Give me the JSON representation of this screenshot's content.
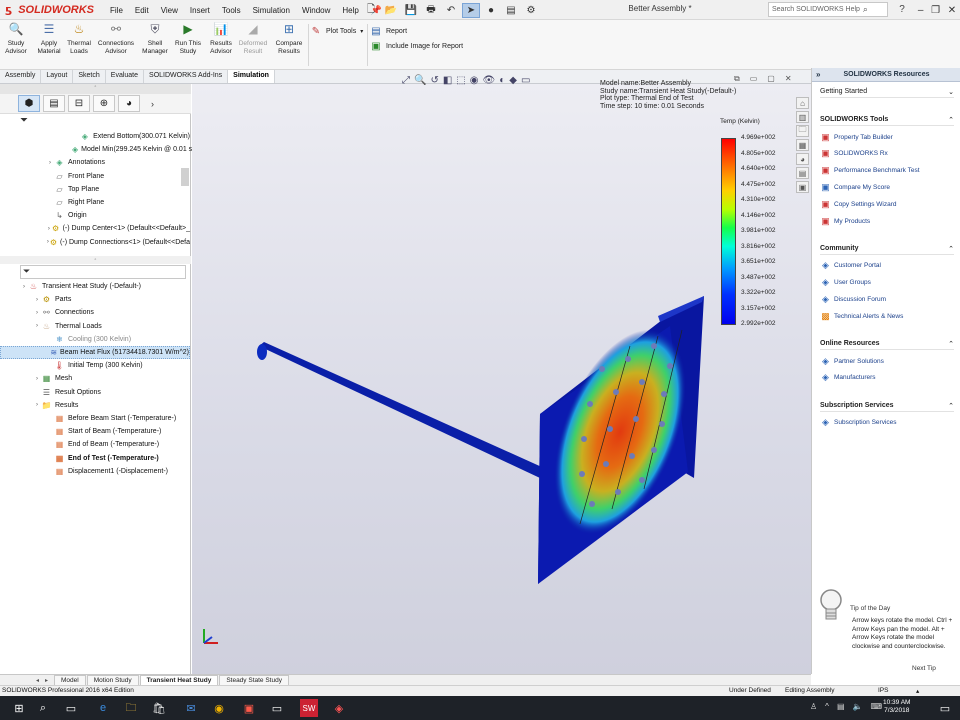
{
  "titlebar": {
    "logo": "SOLIDWORKS",
    "menu": [
      "File",
      "Edit",
      "View",
      "Insert",
      "Tools",
      "Simulation",
      "Window",
      "Help"
    ],
    "document_title": "Better Assembly *",
    "search_placeholder": "Search SOLIDWORKS Help"
  },
  "ribbon": {
    "buttons": [
      {
        "label": "Study Advisor",
        "icon": "study-advisor-icon"
      },
      {
        "label": "Apply Material",
        "icon": "apply-material-icon"
      },
      {
        "label": "Thermal Loads",
        "icon": "thermal-loads-icon"
      },
      {
        "label": "Connections Advisor",
        "icon": "connections-icon"
      },
      {
        "label": "Shell Manager",
        "icon": "shell-manager-icon"
      },
      {
        "label": "Run This Study",
        "icon": "run-study-icon"
      },
      {
        "label": "Results Advisor",
        "icon": "results-advisor-icon"
      },
      {
        "label": "Deformed Result",
        "icon": "deformed-result-icon",
        "disabled": true
      },
      {
        "label": "Compare Results",
        "icon": "compare-results-icon"
      }
    ],
    "plot_tools": "Plot Tools",
    "report": "Report",
    "include_image": "Include Image for Report"
  },
  "command_tabs": [
    "Assembly",
    "Layout",
    "Sketch",
    "Evaluate",
    "SOLIDWORKS Add-Ins",
    "Simulation"
  ],
  "active_command_tab": "Simulation",
  "tree_top": [
    {
      "label": "Extend Bottom(300.071 Kelvin)",
      "indent": 4,
      "icon": "annotation"
    },
    {
      "label": "Model Min(299.245 Kelvin @ 0.01 sec)",
      "indent": 4,
      "icon": "annotation"
    },
    {
      "label": "Annotations",
      "indent": 2,
      "icon": "annotation",
      "expand": true
    },
    {
      "label": "Front Plane",
      "indent": 2,
      "icon": "plane"
    },
    {
      "label": "Top Plane",
      "indent": 2,
      "icon": "plane"
    },
    {
      "label": "Right Plane",
      "indent": 2,
      "icon": "plane"
    },
    {
      "label": "Origin",
      "indent": 2,
      "icon": "origin"
    },
    {
      "label": "(-) Dump Center<1> (Default<<Default>_",
      "indent": 2,
      "icon": "part",
      "expand": true
    },
    {
      "label": "(-) Dump Connections<1> (Default<<Defa",
      "indent": 2,
      "icon": "part",
      "expand": true
    }
  ],
  "tree_study": [
    {
      "label": "Transient Heat Study (-Default-)",
      "indent": 0,
      "icon": "study",
      "expand": true
    },
    {
      "label": "Parts",
      "indent": 1,
      "icon": "parts",
      "expand": true
    },
    {
      "label": "Connections",
      "indent": 1,
      "icon": "connections",
      "expand": true
    },
    {
      "label": "Thermal Loads",
      "indent": 1,
      "icon": "thermal",
      "expand": true
    },
    {
      "label": "Cooling (300 Kelvin)",
      "indent": 2,
      "icon": "cooling",
      "gray": true
    },
    {
      "label": "Beam Heat Flux (51734418.7301 W/m^2)",
      "indent": 2,
      "icon": "flux",
      "selected": true
    },
    {
      "label": "Initial Temp (300 Kelvin)",
      "indent": 2,
      "icon": "temp"
    },
    {
      "label": "Mesh",
      "indent": 1,
      "icon": "mesh",
      "expand": true
    },
    {
      "label": "Result Options",
      "indent": 1,
      "icon": "options"
    },
    {
      "label": "Results",
      "indent": 1,
      "icon": "results",
      "expand": true
    },
    {
      "label": "Before Beam Start (-Temperature-)",
      "indent": 2,
      "icon": "plot"
    },
    {
      "label": "Start of Beam (-Temperature-)",
      "indent": 2,
      "icon": "plot"
    },
    {
      "label": "End of Beam (-Temperature-)",
      "indent": 2,
      "icon": "plot"
    },
    {
      "label": "End of Test (-Temperature-)",
      "indent": 2,
      "icon": "plot",
      "bold": true
    },
    {
      "label": "Displacement1 (-Displacement-)",
      "indent": 2,
      "icon": "plot"
    }
  ],
  "model_info": {
    "name": "Model name:Better Assembly",
    "study": "Study name:Transient Heat Study(-Default-)",
    "plot": "Plot type: Thermal End of Test",
    "time": "Time step: 10   time: 0.01 Seconds"
  },
  "legend": {
    "title": "Temp (Kelvin)",
    "values": [
      "4.969e+002",
      "4.805e+002",
      "4.640e+002",
      "4.475e+002",
      "4.310e+002",
      "4.146e+002",
      "3.981e+002",
      "3.816e+002",
      "3.651e+002",
      "3.487e+002",
      "3.322e+002",
      "3.157e+002",
      "2.992e+002"
    ]
  },
  "resources": {
    "header": "SOLIDWORKS Resources",
    "getting_started": "Getting Started",
    "sections": [
      {
        "title": "SOLIDWORKS Tools",
        "items": [
          "Property Tab Builder",
          "SOLIDWORKS Rx",
          "Performance Benchmark Test",
          "Compare My Score",
          "Copy Settings Wizard",
          "My Products"
        ]
      },
      {
        "title": "Community",
        "items": [
          "Customer Portal",
          "User Groups",
          "Discussion Forum",
          "Technical Alerts & News"
        ]
      },
      {
        "title": "Online Resources",
        "items": [
          "Partner Solutions",
          "Manufacturers"
        ]
      },
      {
        "title": "Subscription Services",
        "items": [
          "Subscription Services"
        ]
      }
    ],
    "tip_title": "Tip of the Day",
    "tip_text": "Arrow keys rotate the model. Ctrl + Arrow Keys pan the model. Alt + Arrow Keys rotate the model clockwise and counterclockwise.",
    "tip_next": "Next Tip"
  },
  "bottom_tabs": [
    "Model",
    "Motion Study",
    "Transient Heat Study",
    "Steady State Study"
  ],
  "active_bottom_tab": "Transient Heat Study",
  "status": {
    "left": "SOLIDWORKS Professional 2016 x64 Edition",
    "defined": "Under Defined",
    "mode": "Editing Assembly",
    "units": "IPS"
  },
  "taskbar": {
    "time": "10:39 AM",
    "date": "7/3/2018"
  },
  "colors": {
    "brand_red": "#d42a20",
    "model_blue": "#0a1fa8",
    "link_blue": "#1a3f8a"
  }
}
